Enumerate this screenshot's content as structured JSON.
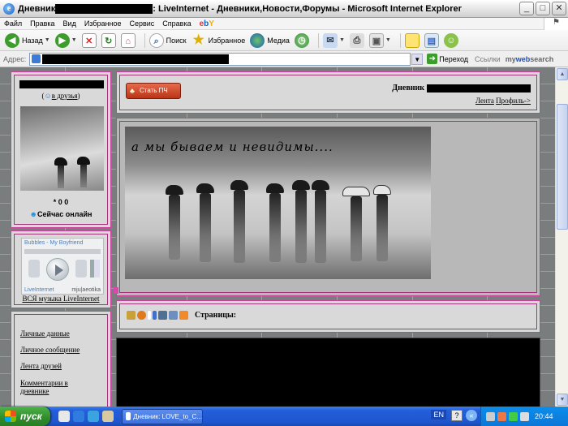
{
  "window": {
    "title_prefix": "Дневник",
    "title_suffix": ": LiveInternet - Дневники,Новости,Форумы - Microsoft Internet Explorer",
    "btn_min": "_",
    "btn_max": "□",
    "btn_close": "✕"
  },
  "menu": {
    "items": [
      "Файл",
      "Правка",
      "Вид",
      "Избранное",
      "Сервис",
      "Справка"
    ],
    "ebay": "ebY"
  },
  "toolbar": {
    "back": "Назад",
    "search": "Поиск",
    "favorites": "Избранное",
    "media": "Медиа"
  },
  "address": {
    "label": "Адрес:",
    "go": "Переход",
    "links": "Ссылки",
    "mws_a": "my",
    "mws_b": "web",
    "mws_c": "search"
  },
  "profile": {
    "friends_open": "(",
    "friends_link": "в друзья",
    "friends_close": ")",
    "stats": "* 0 0",
    "online": "Сейчас онлайн"
  },
  "music": {
    "player_title": "Bubbles - My Boyfriend",
    "player_brand": "LiveInternet",
    "player_brand2": "mju|aeotika",
    "link": "ВСЯ музыка LiveInternet"
  },
  "nav": {
    "items": [
      "Личные данные",
      "Личное сообщение",
      "Лента друзей",
      "Комментарии в",
      "дневнике"
    ]
  },
  "header": {
    "button": "Стать ПЧ",
    "diary_label": "Дневник",
    "link_feed": "Лента",
    "link_profile": "Профиль->"
  },
  "banner": {
    "caption": "а мы бываем и невидимы...."
  },
  "toolstrip": {
    "pages_label": "Страницы:"
  },
  "taskbar": {
    "start": "пуск",
    "task": "Дневник: LOVE_to_C...",
    "lang": "EN",
    "clock": "20:44"
  },
  "colors": {
    "panel_border": "#cc3f9a",
    "page_bg": "#7a7d7e",
    "panel_bg": "#d9d9d9"
  }
}
